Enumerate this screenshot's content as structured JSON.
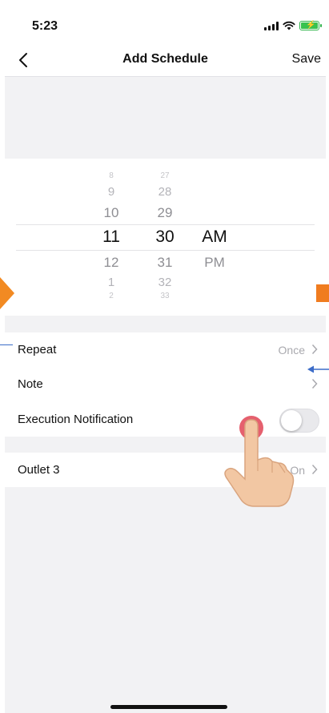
{
  "status_bar": {
    "time": "5:23"
  },
  "nav": {
    "title": "Add Schedule",
    "save_label": "Save"
  },
  "picker": {
    "hours": [
      "8",
      "9",
      "10",
      "11",
      "12",
      "1",
      "2"
    ],
    "minutes": [
      "27",
      "28",
      "29",
      "30",
      "31",
      "32",
      "33"
    ],
    "periods": [
      "AM",
      "PM"
    ],
    "selected": {
      "hour": "11",
      "minute": "30",
      "period": "AM"
    }
  },
  "settings": {
    "repeat": {
      "label": "Repeat",
      "value": "Once"
    },
    "note": {
      "label": "Note",
      "value": ""
    },
    "execution_notification": {
      "label": "Execution Notification",
      "enabled": false
    }
  },
  "device": {
    "label": "Outlet 3",
    "value": "On"
  },
  "colors": {
    "accent_orange": "#f28a22",
    "annotation_blue": "#3c6cc8",
    "battery_green": "#38c24f",
    "tap_red": "#e04455"
  },
  "annotations": {
    "hand_pointer": "hand-pointer-icon"
  }
}
